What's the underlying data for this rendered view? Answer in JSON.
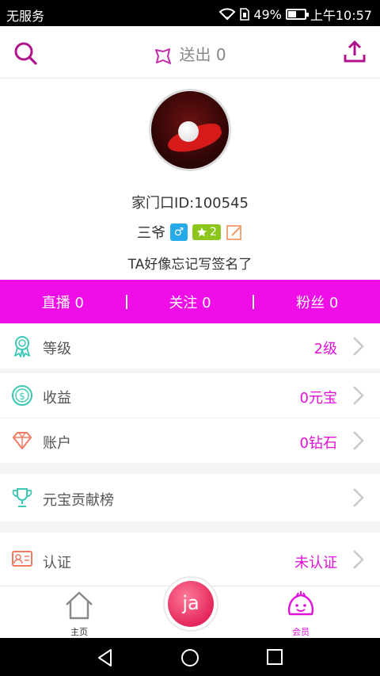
{
  "status_bar": {
    "carrier": "无服务",
    "battery_percent": "49%",
    "battery_level": 0.49,
    "time": "上午10:57"
  },
  "topbar": {
    "sent_label": "送出",
    "sent_count": "0"
  },
  "profile": {
    "home_id": "家门口ID:100545",
    "nickname": "三爷",
    "gender_symbol": "♂",
    "level": "2",
    "signature": "TA好像忘记写签名了"
  },
  "stats": [
    {
      "label": "直播",
      "value": "0"
    },
    {
      "label": "关注",
      "value": "0"
    },
    {
      "label": "粉丝",
      "value": "0"
    }
  ],
  "menu": {
    "level": {
      "label": "等级",
      "value": "2级"
    },
    "income": {
      "label": "收益",
      "value": "0元宝"
    },
    "account": {
      "label": "账户",
      "value": "0钻石"
    },
    "ranking": {
      "label": "元宝贡献榜",
      "value": ""
    },
    "verify": {
      "label": "认证",
      "value": "未认证"
    }
  },
  "bottom_nav": {
    "home_label": "主页",
    "live_label": "ja",
    "member_label": "会员"
  },
  "colors": {
    "accent": "#f00ee8",
    "accent_text": "#e010d8",
    "icon_teal": "#3cc9b4",
    "icon_salmon": "#f07a62",
    "level_badge": "#8cc51c",
    "gender_badge": "#25a9e8"
  },
  "icons": {
    "search": "search-icon",
    "gift": "gift-icon",
    "share": "share-upload-icon",
    "level": "medal-icon",
    "income": "coin-icon",
    "account": "diamond-icon",
    "ranking": "trophy-icon",
    "verify": "id-card-icon",
    "home": "house-icon",
    "member": "member-face-icon"
  }
}
